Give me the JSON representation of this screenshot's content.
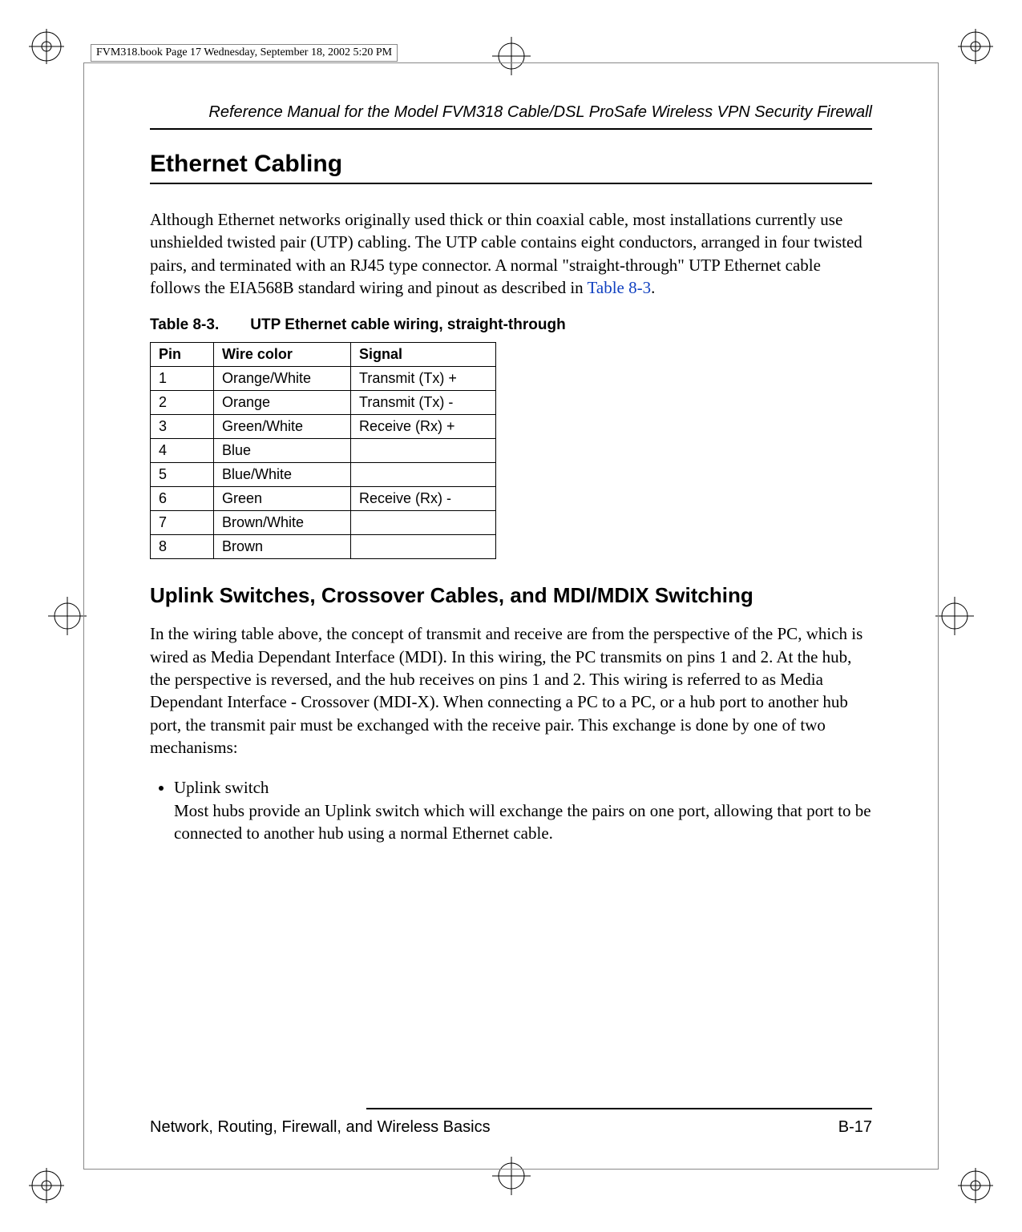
{
  "running_head": "FVM318.book  Page 17  Wednesday, September 18, 2002  5:20 PM",
  "doc_header": "Reference Manual for the Model FVM318 Cable/DSL ProSafe Wireless VPN Security Firewall",
  "section_title": "Ethernet Cabling",
  "intro_paragraph_pre": "Although Ethernet networks originally used thick or thin coaxial cable, most installations currently use unshielded twisted pair (UTP) cabling. The UTP cable contains eight conductors, arranged in four twisted pairs, and terminated with an RJ45 type connector. A normal \"straight-through\" UTP Ethernet cable follows the EIA568B standard wiring and pinout as described in ",
  "table_ref_text": "Table 8-3",
  "intro_paragraph_post": ".",
  "table_caption_num": "Table 8-3.",
  "table_caption_title": "UTP Ethernet cable wiring, straight-through",
  "table_headers": {
    "pin": "Pin",
    "wire_color": "Wire color",
    "signal": "Signal"
  },
  "table_rows": [
    {
      "pin": "1",
      "wire_color": "Orange/White",
      "signal": "Transmit (Tx) +"
    },
    {
      "pin": "2",
      "wire_color": "Orange",
      "signal": "Transmit (Tx) -"
    },
    {
      "pin": "3",
      "wire_color": "Green/White",
      "signal": "Receive (Rx) +"
    },
    {
      "pin": "4",
      "wire_color": "Blue",
      "signal": ""
    },
    {
      "pin": "5",
      "wire_color": "Blue/White",
      "signal": ""
    },
    {
      "pin": "6",
      "wire_color": "Green",
      "signal": "Receive (Rx) -"
    },
    {
      "pin": "7",
      "wire_color": "Brown/White",
      "signal": ""
    },
    {
      "pin": "8",
      "wire_color": "Brown",
      "signal": ""
    }
  ],
  "subsection_title": "Uplink Switches, Crossover Cables, and MDI/MDIX Switching",
  "subsection_paragraph": "In the wiring table above, the concept of transmit and receive are from the perspective of the PC, which is wired as Media Dependant Interface (MDI). In this wiring, the PC transmits on pins 1 and 2. At the hub, the perspective is reversed, and the hub receives on pins 1 and 2. This wiring is referred to as Media Dependant Interface - Crossover (MDI-X). When connecting a PC to a PC, or a hub port to another hub port, the transmit pair must be exchanged with the receive pair. This exchange is done by one of two mechanisms:",
  "bullet_head": "Uplink switch",
  "bullet_body": "Most hubs provide an Uplink switch which will exchange the pairs on one port, allowing that port to be connected to another hub using a normal Ethernet cable.",
  "footer_left": "Network, Routing, Firewall, and Wireless Basics",
  "footer_right": "B-17"
}
